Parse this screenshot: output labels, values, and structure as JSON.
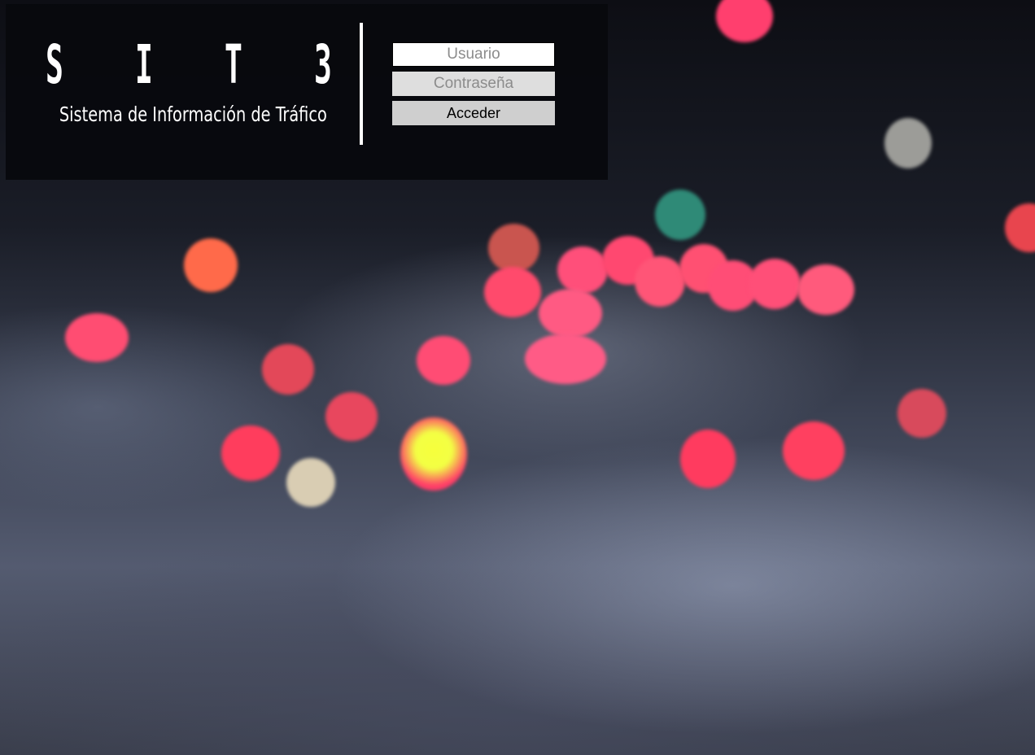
{
  "header": {
    "logo_letters": [
      "S",
      "I",
      "T",
      "3"
    ],
    "subtitle": "Sistema de Información de Tráfico"
  },
  "login": {
    "username_placeholder": "Usuario",
    "password_placeholder": "Contraseña",
    "submit_label": "Acceder"
  },
  "colors": {
    "panel_background": "#08090d",
    "text": "#ffffff",
    "button_background": "#cfcfcf"
  }
}
